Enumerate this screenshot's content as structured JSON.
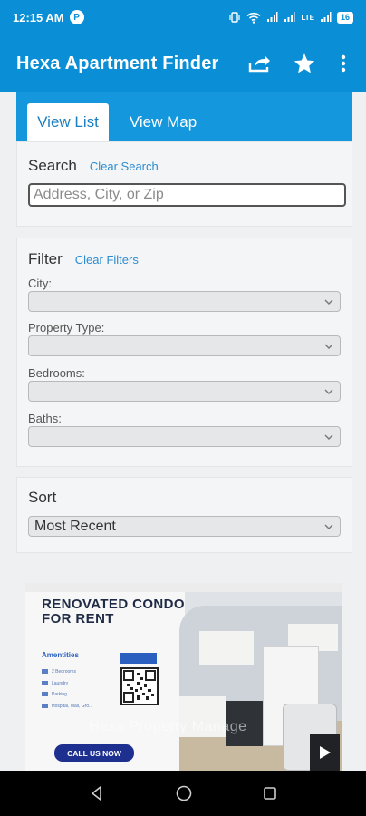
{
  "status_bar": {
    "time": "12:15 AM",
    "notif_letter": "P",
    "network": "LTE",
    "battery": "16"
  },
  "app_bar": {
    "title": "Hexa Apartment Finder",
    "actions": [
      "share-icon",
      "star-icon",
      "more-vert-icon"
    ]
  },
  "tabs": [
    {
      "label": "View List",
      "active": true
    },
    {
      "label": "View Map",
      "active": false
    }
  ],
  "search": {
    "title": "Search",
    "clear_label": "Clear Search",
    "placeholder": "Address, City, or Zip"
  },
  "filter": {
    "title": "Filter",
    "clear_label": "Clear Filters",
    "fields": [
      {
        "label": "City:",
        "value": ""
      },
      {
        "label": "Property Type:",
        "value": ""
      },
      {
        "label": "Bedrooms:",
        "value": ""
      },
      {
        "label": "Baths:",
        "value": ""
      }
    ]
  },
  "sort": {
    "title": "Sort",
    "value": "Most Recent"
  },
  "listing_ad": {
    "headline": "RENOVATED CONDO FOR RENT",
    "amenities_label": "Amentities",
    "amenities": [
      "2 Bedrooms",
      "Laundry",
      "Parking",
      "Hospital, Mall, Gro..."
    ],
    "call_label": "CALL US NOW",
    "watermark": "Hexa Property Manage"
  },
  "colors": {
    "primary": "#0a8fd6",
    "tab_bar": "#1497dc",
    "link": "#2d8ccf"
  }
}
